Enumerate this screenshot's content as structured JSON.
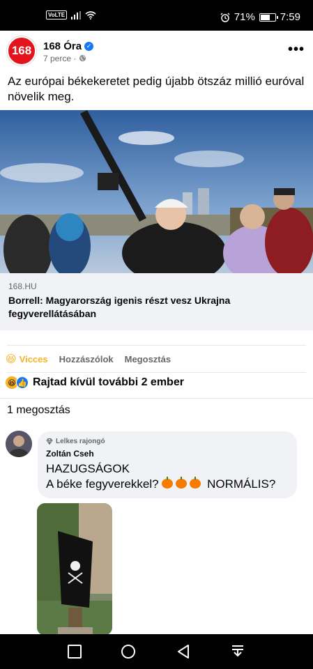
{
  "status_bar": {
    "carrier_badge": "VoLTE",
    "battery": "71%",
    "battery_level": 0.71,
    "time": "7:59"
  },
  "post": {
    "page_logo": "168",
    "page_name": "168 Óra",
    "time_ago": "7 perce",
    "separator": "·",
    "text": "Az európai békekeretet pedig újabb ötszáz millió euróval növelik meg.",
    "link_domain": "168.HU",
    "link_title": "Borrell: Magyarország igenis részt vesz Ukrajna fegyverellátásában"
  },
  "actions": {
    "react_label": "Vicces",
    "comment_label": "Hozzászólok",
    "share_label": "Megosztás"
  },
  "reactions": {
    "summary": "Rajtad kívül további 2 ember"
  },
  "shares": {
    "count_text": "1 megosztás"
  },
  "comment": {
    "badge": "Lelkes rajongó",
    "author": "Zoltán Cseh",
    "line1": "HAZUGSÁGOK",
    "line2_prefix": "A béke fegyverekkel?",
    "line2_suffix": "NORMÁLIS?"
  },
  "colors": {
    "brand_red": "#e3141c",
    "facebook_blue": "#1877f2",
    "haha_yellow": "#f7b125"
  }
}
